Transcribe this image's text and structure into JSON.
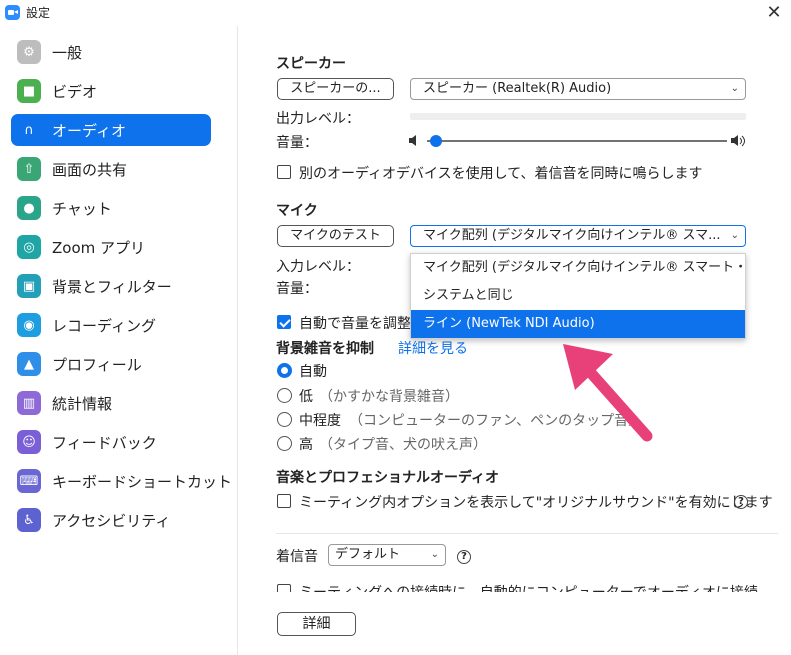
{
  "window": {
    "title": "設定",
    "close_glyph": "✕"
  },
  "sidebar": {
    "items": [
      {
        "label": "一般",
        "icon": "gear-icon",
        "color": "#bdbdbd",
        "glyph": "⚙"
      },
      {
        "label": "ビデオ",
        "icon": "video-icon",
        "color": "#4caf50",
        "glyph": "■"
      },
      {
        "label": "オーディオ",
        "icon": "headphones-icon",
        "color": "#0e72ed",
        "glyph": "∩",
        "active": true
      },
      {
        "label": "画面の共有",
        "icon": "share-screen-icon",
        "color": "#3aa675",
        "glyph": "⇧"
      },
      {
        "label": "チャット",
        "icon": "chat-icon",
        "color": "#2ba58a",
        "glyph": "●"
      },
      {
        "label": "Zoom アプリ",
        "icon": "apps-icon",
        "color": "#1fa5a5",
        "glyph": "◎"
      },
      {
        "label": "背景とフィルター",
        "icon": "background-icon",
        "color": "#23a0b8",
        "glyph": "▣"
      },
      {
        "label": "レコーディング",
        "icon": "record-icon",
        "color": "#1e9de0",
        "glyph": "◉"
      },
      {
        "label": "プロフィール",
        "icon": "profile-icon",
        "color": "#2f8ee8",
        "glyph": "▲"
      },
      {
        "label": "統計情報",
        "icon": "stats-icon",
        "color": "#8e6ad8",
        "glyph": "▥"
      },
      {
        "label": "フィードバック",
        "icon": "feedback-icon",
        "color": "#7b5fd6",
        "glyph": "☺"
      },
      {
        "label": "キーボードショートカット",
        "icon": "keyboard-icon",
        "color": "#6a66d4",
        "glyph": "⌨"
      },
      {
        "label": "アクセシビリティ",
        "icon": "accessibility-icon",
        "color": "#5c62cf",
        "glyph": "♿"
      }
    ]
  },
  "speaker": {
    "title": "スピーカー",
    "test_button": "スピーカーの...",
    "device": "スピーカー (Realtek(R) Audio)",
    "output_level_label": "出力レベル：",
    "volume_label": "音量：",
    "volume_level": 0.03
  },
  "separate_device": {
    "label": "別のオーディオデバイスを使用して、着信音を同時に鳴らします",
    "checked": false
  },
  "mic": {
    "title": "マイク",
    "test_button": "マイクのテスト",
    "device": "マイク配列 (デジタルマイク向けインテル® スマ...",
    "input_level_label": "入力レベル：",
    "volume_label": "音量：",
    "options": [
      {
        "label": "マイク配列 (デジタルマイク向けインテル® スマート・..."
      },
      {
        "label": "システムと同じ"
      },
      {
        "label": "ライン (NewTek NDI Audio)",
        "selected": true
      }
    ]
  },
  "auto_adjust": {
    "label": "自動で音量を調整",
    "checked": true
  },
  "noise": {
    "title": "背景雑音を抑制",
    "link": "詳細を見る",
    "options": [
      {
        "label": "自動",
        "note": "",
        "checked": true
      },
      {
        "label": "低",
        "note": "（かすかな背景雑音）",
        "checked": false
      },
      {
        "label": "中程度",
        "note": "（コンピューターのファン、ペンのタップ音）",
        "checked": false
      },
      {
        "label": "高",
        "note": "（タイプ音、犬の吠え声）",
        "checked": false
      }
    ]
  },
  "music": {
    "title": "音楽とプロフェショナルオーディオ",
    "original_sound_label": "ミーティング内オプションを表示して\"オリジナルサウンド\"を有効にします",
    "help_glyph": "?"
  },
  "ringtone": {
    "label": "着信音",
    "value": "デフォルト",
    "help_glyph": "?"
  },
  "auto_join": {
    "label": "ミーティングへの接続時に、自動的にコンピューターでオーディオに接続"
  },
  "advanced_button": "詳細",
  "colors": {
    "accent": "#0e72ed",
    "annotation_arrow": "#e8417a"
  }
}
